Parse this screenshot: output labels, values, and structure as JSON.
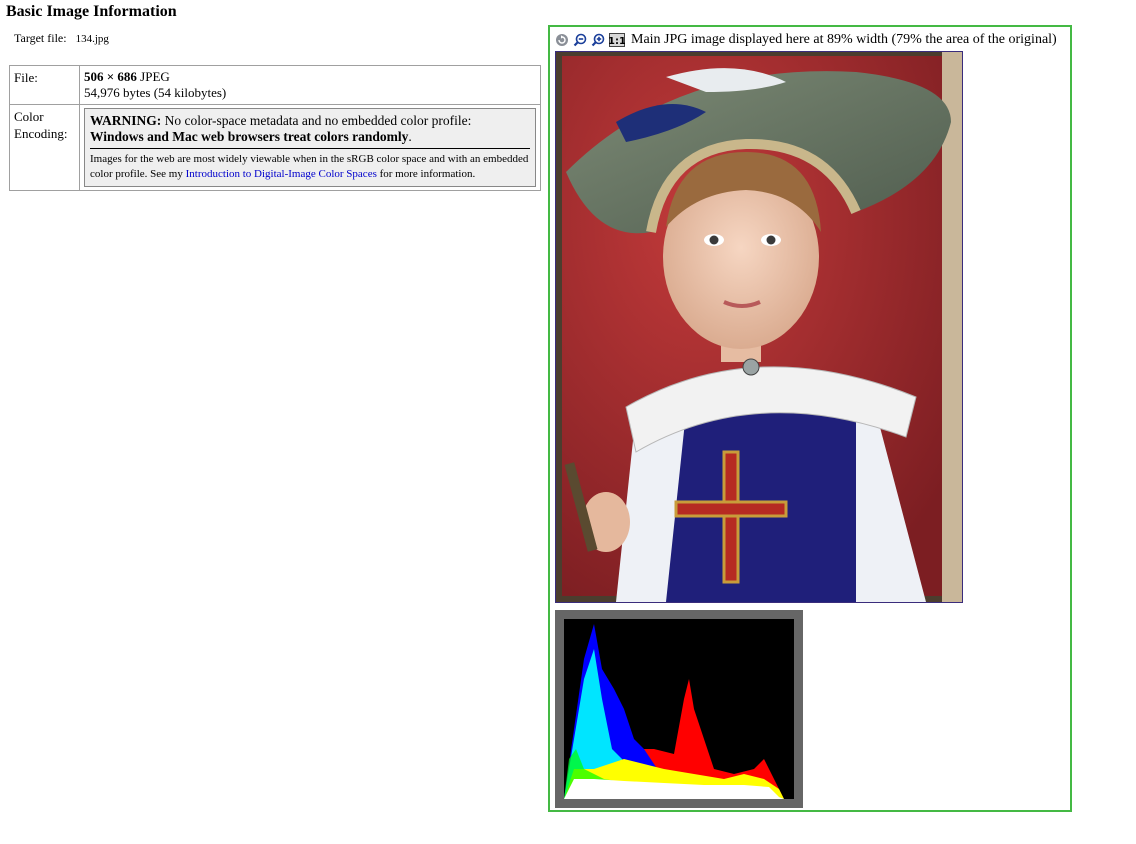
{
  "page": {
    "title": "Basic Image Information",
    "target_label": "Target file:",
    "target_value": "134.jpg"
  },
  "info_table": {
    "file_label": "File:",
    "dims_bold": "506 × 686",
    "dims_format": "JPEG",
    "bytes_line": "54,976 bytes (54 kilobytes)",
    "color_label_1": "Color",
    "color_label_2": "Encoding:",
    "warning_strong": "WARNING:",
    "warning_text": "No color-space metadata and no embedded color profile:",
    "warning_bold_line": "Windows and Mac web browsers treat colors randomly",
    "warning_period": ".",
    "info_text_before": "Images for the web are most widely viewable when in the sRGB color space and with an embedded color profile. See my",
    "info_link": "Introduction to Digital-Image Color Spaces",
    "info_text_after": "for more information."
  },
  "viewer": {
    "caption": "Main JPG image displayed here at 89% width (79% the area of the original)",
    "icons": [
      "reload-icon",
      "zoom-out-icon",
      "zoom-in-icon",
      "actual-size-icon"
    ],
    "actual_size_label": "1:1",
    "border_color": "#44b944"
  },
  "photo": {
    "description_colors": {
      "background": "#a82a2a",
      "hat": "#6c7a64",
      "costume": "#1e1e78",
      "collar": "#e8ecf2"
    }
  },
  "histogram": {
    "background": "#000000",
    "frame": "#666666",
    "channels": [
      "red",
      "green",
      "blue",
      "yellow",
      "cyan",
      "white"
    ]
  }
}
